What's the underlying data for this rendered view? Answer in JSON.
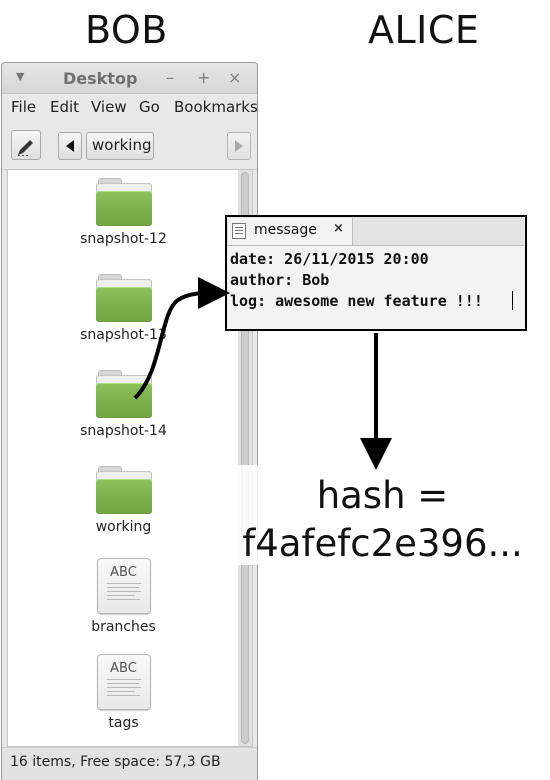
{
  "headings": {
    "left": "BOB",
    "right": "ALICE"
  },
  "window": {
    "title": "Desktop",
    "menu_icon": "triangle-down-icon",
    "controls": [
      "–",
      "+",
      "×"
    ],
    "menu": [
      "File",
      "Edit",
      "View",
      "Go",
      "Bookmarks"
    ],
    "toolbar": {
      "location": "working",
      "edit_icon": "pencil-icon",
      "back_icon": "left-arrow-icon",
      "forward_icon": "right-arrow-icon"
    },
    "items": [
      {
        "name": "snapshot-12",
        "type": "folder"
      },
      {
        "name": "snapshot-13",
        "type": "folder"
      },
      {
        "name": "snapshot-14",
        "type": "folder"
      },
      {
        "name": "working",
        "type": "folder"
      },
      {
        "name": "branches",
        "type": "text-file",
        "icon_text": "ABC"
      },
      {
        "name": "tags",
        "type": "text-file",
        "icon_text": "ABC"
      }
    ],
    "status": "16 items, Free space: 57,3 GB"
  },
  "message": {
    "tab_label": "message",
    "close_label": "×",
    "lines": [
      "date: 26/11/2015 20:00",
      "author: Bob",
      "log: awesome new feature !!!"
    ]
  },
  "hash": {
    "line1": "hash =",
    "line2": "f4afefc2e396..."
  },
  "colors": {
    "folder_green": "#7bb14a",
    "connector": "#000000"
  }
}
